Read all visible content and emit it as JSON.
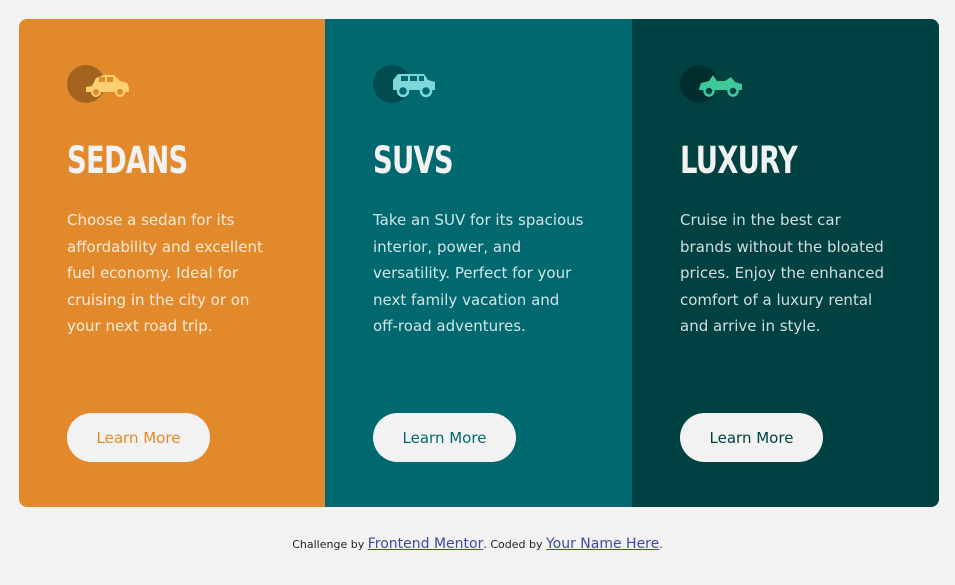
{
  "cards": [
    {
      "icon": "sedan-car-icon",
      "title": "Sedans",
      "text": "Choose a sedan for its affordability and excellent fuel economy. Ideal for cruising in the city or on your next road trip.",
      "button": "Learn More",
      "bg": "#e28a2b",
      "accent": "#e28a2b",
      "icon_color": "#ffd070"
    },
    {
      "icon": "suv-car-icon",
      "title": "SUVs",
      "text": "Take an SUV for its spacious interior, power, and versatility. Perfect for your next family vacation and off-road adventures.",
      "button": "Learn More",
      "bg": "#006970",
      "accent": "#006970",
      "icon_color": "#7fd8d8"
    },
    {
      "icon": "luxury-car-icon",
      "title": "Luxury",
      "text": "Cruise in the best car brands without the bloated prices. Enjoy the enhanced comfort of a luxury rental and arrive in style.",
      "button": "Learn More",
      "bg": "#004141",
      "accent": "#004141",
      "icon_color": "#3fc99b"
    }
  ],
  "footer": {
    "prefix": "Challenge by ",
    "link1": "Frontend Mentor",
    "middle": ". Coded by ",
    "link2": "Your Name Here",
    "suffix": "."
  }
}
